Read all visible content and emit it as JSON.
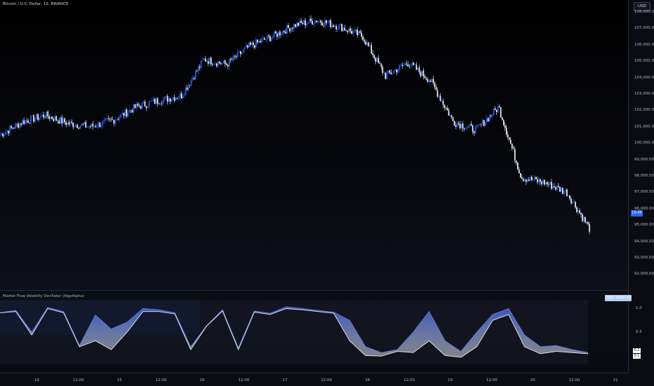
{
  "symbol": {
    "title": "Bitcoin / U.S. Dollar, 15, BINANCE"
  },
  "currency_button": "USD",
  "price_axis": {
    "labels": [
      "108,000.00",
      "107,000.00",
      "106,000.00",
      "105,000.00",
      "104,000.00",
      "103,000.00",
      "102,000.00",
      "101,000.00",
      "100,000.00",
      "99,000.00",
      "98,000.00",
      "97,000.00",
      "96,000.00",
      "95,000.00",
      "94,000.00",
      "93,000.00",
      "92,000.00"
    ]
  },
  "last_price_tag": "10:45",
  "oscillator": {
    "title": "Market Flow Volatility Oscillator (AlgoAlpha)",
    "badge": "High Volatility",
    "scale_labels": [
      "1.0",
      "0.5"
    ],
    "value_tags": [
      "0.2",
      "0.1"
    ]
  },
  "time_axis": {
    "labels": [
      "14",
      "12:00",
      "15",
      "12:00",
      "16",
      "12:00",
      "17",
      "12:00",
      "18",
      "12:00",
      "19",
      "12:00",
      "20",
      "12:00",
      "21"
    ]
  },
  "colors": {
    "candle": "#ffffff",
    "accent": "#2962ff",
    "osc_high": "#3d5fd6",
    "osc_low": "#d8dbe3",
    "grid": "#1c2030"
  },
  "chart_data": [
    {
      "type": "line",
      "description_series": "BTC price (15m)",
      "series": [
        {
          "x": [
            "14 00:00",
            "14 06:00",
            "14 12:00",
            "14 18:00",
            "15 00:00",
            "15 06:00",
            "15 12:00",
            "15 18:00",
            "16 00:00",
            "16 06:00",
            "16 12:00",
            "16 18:00",
            "17 00:00",
            "17 06:00",
            "17 12:00",
            "17 18:00",
            "18 00:00",
            "18 06:00",
            "18 12:00",
            "18 18:00",
            "19 00:00",
            "19 06:00",
            "19 12:00",
            "19 18:00",
            "20 00:00",
            "20 06:00",
            "20 12:00"
          ],
          "values": [
            100500,
            101300,
            101700,
            101200,
            101000,
            101400,
            102200,
            102600,
            102900,
            105100,
            104800,
            105900,
            106500,
            107200,
            107500,
            107100,
            106500,
            104100,
            104900,
            103800,
            101300,
            100800,
            102200,
            97900,
            97600,
            97000,
            94800
          ]
        }
      ],
      "ylim": [
        91500,
        108500
      ]
    },
    {
      "type": "area",
      "series": [
        {
          "name": "",
          "values": [
            0.88,
            0.92,
            0.55,
            0.97,
            0.9,
            0.32,
            0.84,
            0.6,
            0.72,
            0.95,
            0.93,
            0.88,
            0.3,
            0.66,
            0.93,
            0.28,
            0.91,
            0.87,
            0.98,
            0.95,
            0.92,
            0.89,
            0.75,
            0.3,
            0.2,
            0.25,
            0.55,
            0.9,
            0.4,
            0.22,
            0.55,
            0.85,
            0.95,
            0.5,
            0.3,
            0.32,
            0.25,
            0.2
          ]
        },
        {
          "name": "",
          "values": [
            0.88,
            0.9,
            0.5,
            0.95,
            0.88,
            0.3,
            0.4,
            0.25,
            0.55,
            0.9,
            0.9,
            0.86,
            0.25,
            0.65,
            0.91,
            0.25,
            0.89,
            0.85,
            0.95,
            0.93,
            0.9,
            0.87,
            0.4,
            0.15,
            0.14,
            0.22,
            0.2,
            0.4,
            0.15,
            0.12,
            0.3,
            0.75,
            0.85,
            0.3,
            0.18,
            0.22,
            0.2,
            0.18
          ]
        }
      ],
      "ylim": [
        0,
        1.1
      ]
    }
  ]
}
